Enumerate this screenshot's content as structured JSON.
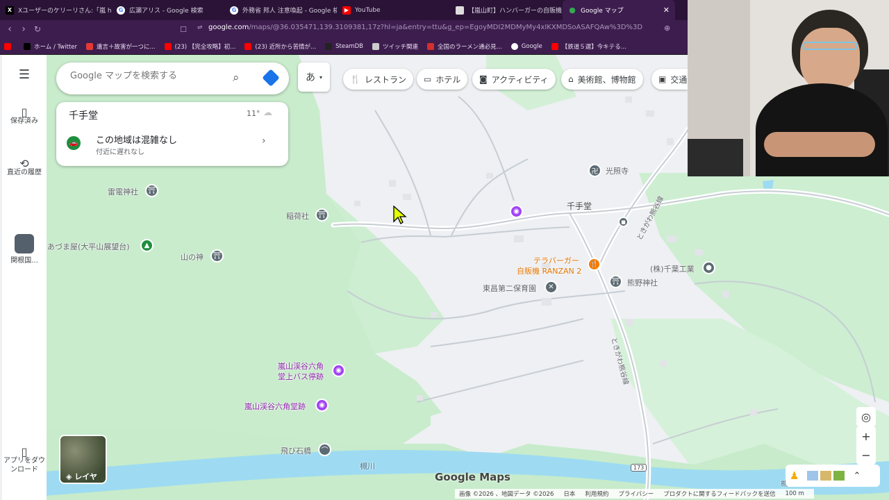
{
  "tabs": [
    {
      "title": "Xユーザーのケリーリさん:「嵐 https://t.co/..."
    },
    {
      "title": "広瀬アリス - Google 検索"
    },
    {
      "title": "外務省 邦人 注意喚起 - Google 検索"
    },
    {
      "title": "YouTube"
    },
    {
      "title": "【嵐山町】ハンバーガーの自販機を発見し..."
    },
    {
      "title": "Google マップ"
    }
  ],
  "url": {
    "host": "google.com",
    "path": "/maps/@36.035471,139.3109381,17z?hl=ja&entry=ttu&g_ep=EgoyMDI2MDMyMy4xIKXMDSoASAFQAw%3D%3D"
  },
  "bookmarks": [
    "ホーム / Twitter",
    "遺言＋故害が一つに...",
    "(23) 【完全攻略】初...",
    "(23) 近所から苦情が...",
    "SteamDB",
    "ツイッチ関連",
    "全国のラーメン通必見...",
    "Google",
    "【鉄道５選】今キテる..."
  ],
  "rail": {
    "saved": "保存済み",
    "recent": "直近の履歴",
    "place": "関根国...",
    "app": "アプリをダウンロード",
    "layers": "レイヤ"
  },
  "search": {
    "placeholder": "Google マップを検索する"
  },
  "ime": "あ",
  "chips": [
    "レストラン",
    "ホテル",
    "アクティビティ",
    "美術館、博物館",
    "交通"
  ],
  "card": {
    "title": "千手堂",
    "temp": "11°",
    "status": "この地域は混雑なし",
    "sub": "付近に遅れなし"
  },
  "map_labels": {
    "raiden": "雷電神社",
    "inari": "稲荷社",
    "azumaya": "あづま屋(大平山展望台)",
    "yamanokami": "山の神",
    "koshoji": "光照寺",
    "senjudo": "千手堂",
    "teraburger_1": "テラバーガー",
    "teraburger_2": "自販機 RANZAN 2",
    "chibakogyo": "(株)千葉工業",
    "kumano": "熊野神社",
    "hoikuen": "東昌第二保育園",
    "bus_1": "嵐山渓谷六角",
    "bus_2": "堂上バス停跡",
    "rokkakudo": "嵐山渓谷六角堂跡",
    "tobiishi": "飛び石橋",
    "tsukigawa": "槻川",
    "road_1": "ときがわ熊谷線",
    "road_2": "ときがわ熊谷線",
    "route": "173",
    "edge_river": "槻川"
  },
  "logo": "Google Maps",
  "footer": [
    "画像 ©2026 、地図データ ©2026",
    "日本",
    "利用規約",
    "プライバシー",
    "プロダクトに関するフィードバックを送信",
    "100 m"
  ],
  "colors": {
    "chrome_bg": "#3d1d4e",
    "tab_bg": "#2a1336",
    "park_green": "#c9eccd",
    "river_blue": "#9edbf2",
    "place_purple": "#a142f4",
    "food_orange": "#f57c00",
    "transit_gray": "#5c6b73"
  }
}
